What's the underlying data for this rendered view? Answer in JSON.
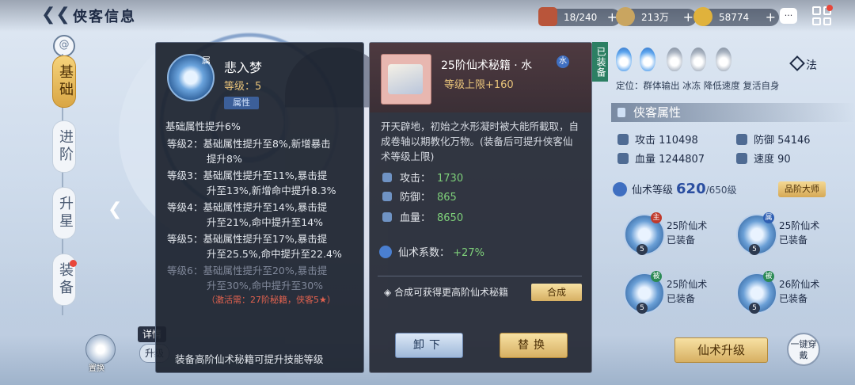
{
  "header": {
    "title": "侠客信息",
    "resources": [
      {
        "icon": "chest-icon",
        "value": "18/240"
      },
      {
        "icon": "copper-coin-icon",
        "value": "213万"
      },
      {
        "icon": "gold-ingot-icon",
        "value": "58774"
      }
    ]
  },
  "left_tabs": [
    "基础",
    "进阶",
    "升星",
    "装备"
  ],
  "skill_panel": {
    "badge": "属",
    "name": "悲入梦",
    "level": "等级：5",
    "tag": "属性",
    "lines": [
      "基础属性提升6%",
      "等级2：基础属性提升至8%,新增暴击",
      "提升8%",
      "等级3：基础属性提升至11%,暴击提",
      "升至13%,新增命中提升8.3%",
      "等级4：基础属性提升至14%,暴击提",
      "升至21%,命中提升至14%",
      "等级5：基础属性提升至17%,暴击提",
      "升至25.5%,命中提升至22.4%"
    ],
    "locked_lines": [
      "等级6：基础属性提升至20%,暴击提",
      "升至30%,命中提升至30%"
    ],
    "locked_note": "（激活需：27阶秘籍，侠客5★）",
    "footer": "装备高阶仙术秘籍可提升技能等级"
  },
  "book_panel": {
    "name": "25阶仙术秘籍 · 水",
    "element": "水",
    "level_cap": "等级上限+160",
    "desc": "开天辟地，初始之水形凝时被大能所截取，自成卷轴以期教化万物。(装备后可提升侠客仙术等级上限)",
    "stats": [
      {
        "label": "攻击：",
        "value": "1730"
      },
      {
        "label": "防御：",
        "value": "865"
      },
      {
        "label": "血量：",
        "value": "8650"
      }
    ],
    "coef_label": "仙术系数：",
    "coef_value": "+27%",
    "synth_text": "合成可获得更高阶仙术秘籍",
    "synth_btn": "合成",
    "unequip_btn": "卸下",
    "replace_btn": "替换",
    "equipped_tag": "已装备"
  },
  "right_panel": {
    "method": "法",
    "position": "定位：群体输出 冰冻 降低速度 复活自身",
    "section_title": "侠客属性",
    "attrs": [
      {
        "label": "攻击",
        "value": "110498"
      },
      {
        "label": "防御",
        "value": "54146"
      },
      {
        "label": "血量",
        "value": "1244807"
      },
      {
        "label": "速度",
        "value": "90"
      }
    ],
    "xianshu_label": "仙术等级",
    "xianshu_level": "620",
    "xianshu_max": "/650级",
    "rank": "品阶大师",
    "slots": [
      {
        "badge": "主",
        "badge_color": "#c0392b",
        "title": "25阶仙术",
        "status": "已装备",
        "num": "5"
      },
      {
        "badge": "属",
        "badge_color": "#2f5fb3",
        "title": "25阶仙术",
        "status": "已装备",
        "num": "5"
      },
      {
        "badge": "被",
        "badge_color": "#2c8a55",
        "title": "25阶仙术",
        "status": "已装备",
        "num": "5"
      },
      {
        "badge": "被",
        "badge_color": "#2c8a55",
        "title": "26阶仙术",
        "status": "已装备",
        "num": "5"
      }
    ],
    "upgrade_btn": "仙术升级",
    "onekey_btn": "一键穿戴"
  },
  "bottom_left": {
    "replace": "置换",
    "detail": "详情",
    "upgrade": "升级"
  }
}
